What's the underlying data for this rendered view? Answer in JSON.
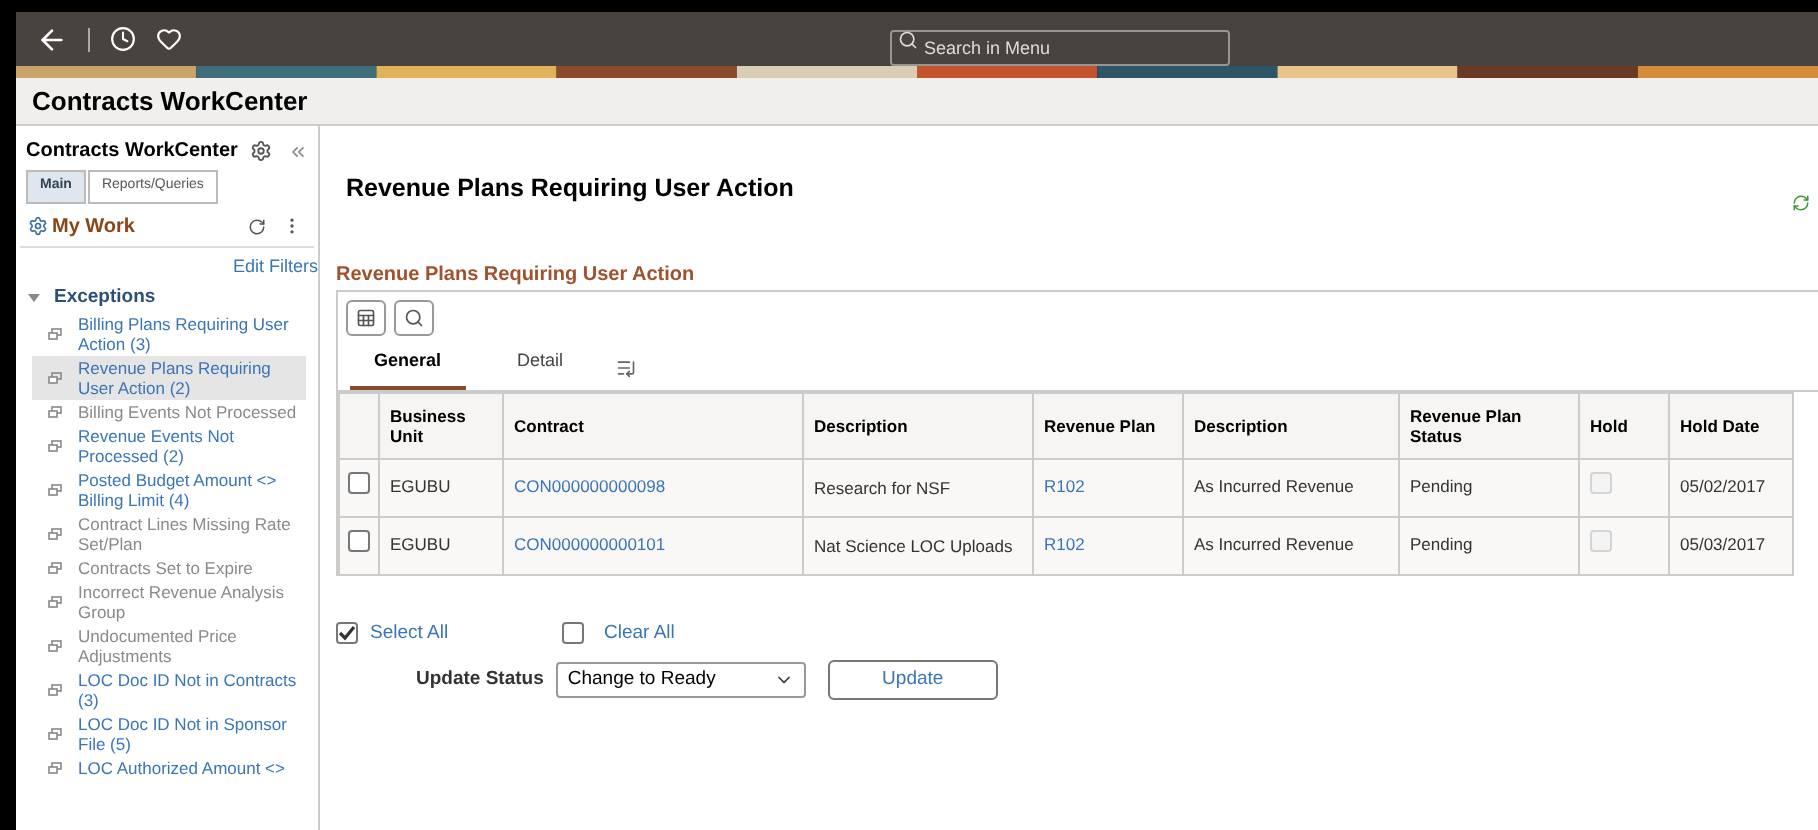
{
  "top_bar": {
    "search": {
      "placeholder": "Search in Menu"
    }
  },
  "page_title": "Contracts WorkCenter",
  "sidebar": {
    "title": "Contracts WorkCenter",
    "tabs": [
      {
        "label": "Main",
        "selected": true
      },
      {
        "label": "Reports/Queries",
        "selected": false
      }
    ],
    "section": "My Work",
    "edit_filters": "Edit Filters",
    "group": {
      "label": "Exceptions",
      "expanded": true
    },
    "items": [
      {
        "label": "Billing Plans Requiring User Action (3)",
        "disabled": false,
        "selected": false
      },
      {
        "label": "Revenue Plans Requiring User Action (2)",
        "disabled": false,
        "selected": true
      },
      {
        "label": "Billing Events Not Processed",
        "disabled": true,
        "selected": false
      },
      {
        "label": "Revenue Events Not Processed (2)",
        "disabled": false,
        "selected": false
      },
      {
        "label": "Posted Budget Amount <> Billing Limit (4)",
        "disabled": false,
        "selected": false
      },
      {
        "label": "Contract Lines Missing Rate Set/Plan",
        "disabled": true,
        "selected": false
      },
      {
        "label": "Contracts Set to Expire",
        "disabled": true,
        "selected": false
      },
      {
        "label": "Incorrect Revenue Analysis Group",
        "disabled": true,
        "selected": false
      },
      {
        "label": "Undocumented Price Adjustments",
        "disabled": true,
        "selected": false
      },
      {
        "label": "LOC Doc ID Not in Contracts (3)",
        "disabled": false,
        "selected": false
      },
      {
        "label": "LOC Doc ID Not in Sponsor File (5)",
        "disabled": false,
        "selected": false
      },
      {
        "label": "LOC Authorized Amount <>",
        "disabled": false,
        "selected": false
      }
    ]
  },
  "main": {
    "title": "Revenue Plans Requiring User Action",
    "grid_title": "Revenue Plans Requiring User Action",
    "grid_tabs": [
      {
        "label": "General",
        "selected": true
      },
      {
        "label": "Detail",
        "selected": false
      }
    ],
    "table": {
      "columns": [
        "Business Unit",
        "Contract",
        "Description",
        "Revenue Plan",
        "Description",
        "Revenue Plan Status",
        "Hold",
        "Hold Date"
      ],
      "rows": [
        {
          "selected": false,
          "business_unit": "EGUBU",
          "contract": "CON000000000098",
          "description": "Research for NSF",
          "revenue_plan": "R102",
          "plan_description": "As Incurred Revenue",
          "status": "Pending",
          "hold": false,
          "hold_date": "05/02/2017"
        },
        {
          "selected": false,
          "business_unit": "EGUBU",
          "contract": "CON000000000101",
          "description": "Nat Science LOC Uploads",
          "revenue_plan": "R102",
          "plan_description": "As Incurred Revenue",
          "status": "Pending",
          "hold": false,
          "hold_date": "05/03/2017"
        }
      ]
    },
    "select_all": {
      "label": "Select All",
      "checked": true
    },
    "clear_all": {
      "label": "Clear All",
      "checked": false
    },
    "update_status": {
      "label": "Update Status",
      "value": "Change to Ready"
    },
    "update_button": "Update"
  }
}
